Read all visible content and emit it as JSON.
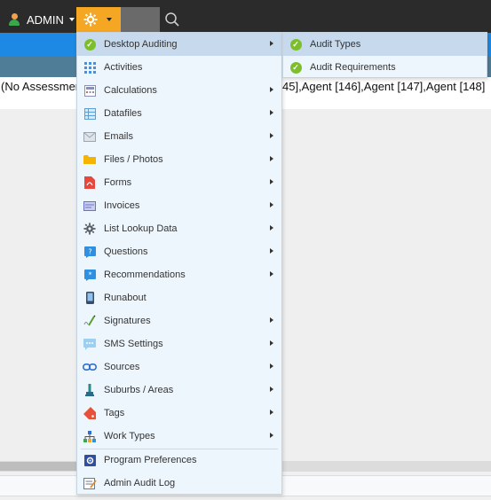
{
  "topbar": {
    "user_label": "ADMIN",
    "gear_icon": "gear-icon",
    "search_icon": "search-icon",
    "accent_color": "#f5a623"
  },
  "page": {
    "results_left": "(No Assessmen",
    "results_right": "45],Agent [146],Agent [147],Agent [148]"
  },
  "menu": {
    "items": [
      {
        "label": "Desktop Auditing",
        "icon": "check-circle-icon",
        "submenu": true,
        "active": true
      },
      {
        "label": "Activities",
        "icon": "grid-icon",
        "submenu": false
      },
      {
        "label": "Calculations",
        "icon": "calculator-icon",
        "submenu": true
      },
      {
        "label": "Datafiles",
        "icon": "table-icon",
        "submenu": true
      },
      {
        "label": "Emails",
        "icon": "envelope-icon",
        "submenu": true
      },
      {
        "label": "Files / Photos",
        "icon": "folder-icon",
        "submenu": true
      },
      {
        "label": "Forms",
        "icon": "pdf-icon",
        "submenu": true
      },
      {
        "label": "Invoices",
        "icon": "invoice-icon",
        "submenu": true
      },
      {
        "label": "List Lookup Data",
        "icon": "cog-icon",
        "submenu": true
      },
      {
        "label": "Questions",
        "icon": "question-icon",
        "submenu": true
      },
      {
        "label": "Recommendations",
        "icon": "recommendation-icon",
        "submenu": true
      },
      {
        "label": "Runabout",
        "icon": "phone-icon",
        "submenu": false
      },
      {
        "label": "Signatures",
        "icon": "signature-icon",
        "submenu": true
      },
      {
        "label": "SMS Settings",
        "icon": "sms-icon",
        "submenu": true
      },
      {
        "label": "Sources",
        "icon": "link-icon",
        "submenu": true
      },
      {
        "label": "Suburbs / Areas",
        "icon": "pin-icon",
        "submenu": true
      },
      {
        "label": "Tags",
        "icon": "tag-icon",
        "submenu": true
      },
      {
        "label": "Work Types",
        "icon": "hierarchy-icon",
        "submenu": true
      }
    ],
    "bottom_items": [
      {
        "label": "Program Preferences",
        "icon": "preferences-icon"
      },
      {
        "label": "Admin Audit Log",
        "icon": "audit-log-icon"
      }
    ]
  },
  "submenu": {
    "items": [
      {
        "label": "Audit Types",
        "icon": "check-circle-icon",
        "active": true
      },
      {
        "label": "Audit Requirements",
        "icon": "check-circle-icon"
      }
    ]
  }
}
